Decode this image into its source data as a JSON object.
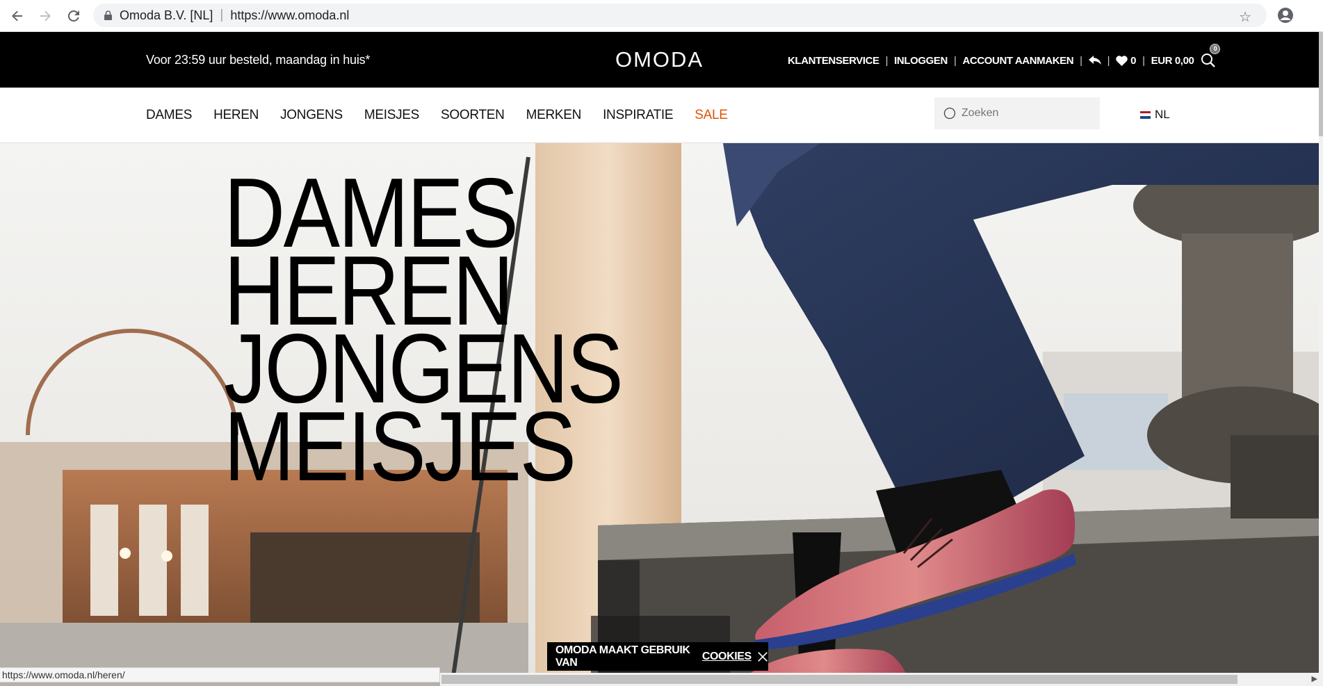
{
  "browser": {
    "site_name": "Omoda B.V. [NL]",
    "url": "https://www.omoda.nl"
  },
  "topbar": {
    "promo": "Voor 23:59 uur besteld, maandag in huis*",
    "logo": "OMODA",
    "links": {
      "customer_service": "KLANTENSERVICE",
      "login": "INLOGGEN",
      "create_account": "ACCOUNT AANMAKEN",
      "wishlist_count": "0",
      "cart_total": "EUR 0,00",
      "cart_badge": "0"
    }
  },
  "mainnav": {
    "items": [
      "DAMES",
      "HEREN",
      "JONGENS",
      "MEISJES",
      "SOORTEN",
      "MERKEN",
      "INSPIRATIE",
      "SALE"
    ],
    "search_placeholder": "Zoeken",
    "language": "NL"
  },
  "hero": {
    "links": [
      "DAMES",
      "HEREN",
      "JONGENS",
      "MEISJES"
    ]
  },
  "cookie": {
    "text": "OMODA MAAKT GEBRUIK VAN",
    "link": "COOKIES"
  },
  "statusbar": {
    "url": "https://www.omoda.nl/heren/"
  },
  "colors": {
    "sale": "#e05206",
    "topbar_bg": "#000000"
  }
}
